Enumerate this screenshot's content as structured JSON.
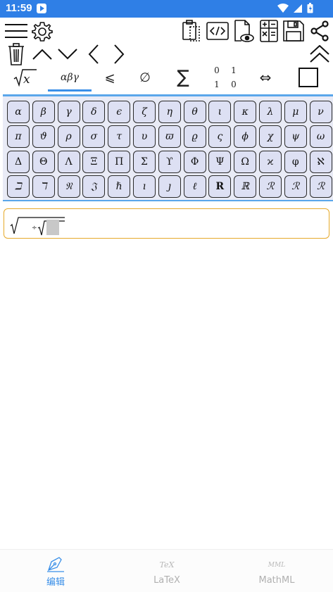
{
  "status_bar": {
    "time": "11:59",
    "icons": [
      "wifi-icon",
      "signal-icon",
      "battery-icon"
    ]
  },
  "toolbar": {
    "row1_left": [
      "menu-icon",
      "settings-gear-icon"
    ],
    "row1_right": [
      "clipboard-icon",
      "code-icon",
      "preview-document-icon",
      "calculator-icon",
      "save-icon",
      "share-icon"
    ],
    "row2_left": [
      "trash-icon",
      "chevron-up-icon",
      "chevron-down-icon",
      "chevron-left-icon",
      "chevron-right-icon"
    ],
    "row2_right": [
      "double-chevron-up-icon"
    ]
  },
  "tabs": [
    {
      "label": "√x",
      "name": "tab-radicals"
    },
    {
      "label": "αβγ",
      "name": "tab-greek",
      "active": true
    },
    {
      "label": "⩽",
      "name": "tab-relations"
    },
    {
      "label": "∅",
      "name": "tab-sets"
    },
    {
      "label": "∑",
      "name": "tab-big-operators"
    },
    {
      "label": "matrix",
      "name": "tab-matrices",
      "cells": [
        "0",
        "1",
        "1",
        "0"
      ]
    },
    {
      "label": "⇔",
      "name": "tab-arrows"
    },
    {
      "label": "□",
      "name": "tab-placeholder"
    }
  ],
  "symbols": {
    "row1": [
      "α",
      "β",
      "γ",
      "δ",
      "ϵ",
      "ζ",
      "η",
      "θ",
      "ι",
      "κ",
      "λ",
      "μ",
      "ν"
    ],
    "row2": [
      "π",
      "ϑ",
      "ρ",
      "σ",
      "τ",
      "υ",
      "ϖ",
      "ϱ",
      "ς",
      "ϕ",
      "χ",
      "ψ",
      "ω"
    ],
    "row3": [
      "Δ",
      "Θ",
      "Λ",
      "Ξ",
      "Π",
      "Σ",
      "ϒ",
      "Φ",
      "Ψ",
      "Ω",
      "ϰ",
      "φ",
      "ℵ"
    ],
    "row4": [
      "ℶ",
      "ℸ",
      "𝔑",
      "𝔍",
      "ℏ",
      "ı",
      "ȷ",
      "ℓ",
      "𝐑",
      "ℝ",
      "ℛ",
      "ℛ",
      "ℛ"
    ]
  },
  "editor": {
    "content": "nested square root with placeholder"
  },
  "accent_color": "#3a8fe8",
  "editor_border_color": "#e6a92a",
  "bottom_nav": [
    {
      "label": "编辑",
      "icon": "pen-icon",
      "active": true
    },
    {
      "label": "LaTeX",
      "icon_text": "TeX",
      "active": false
    },
    {
      "label": "MathML",
      "icon_text": "MML",
      "active": false
    }
  ]
}
